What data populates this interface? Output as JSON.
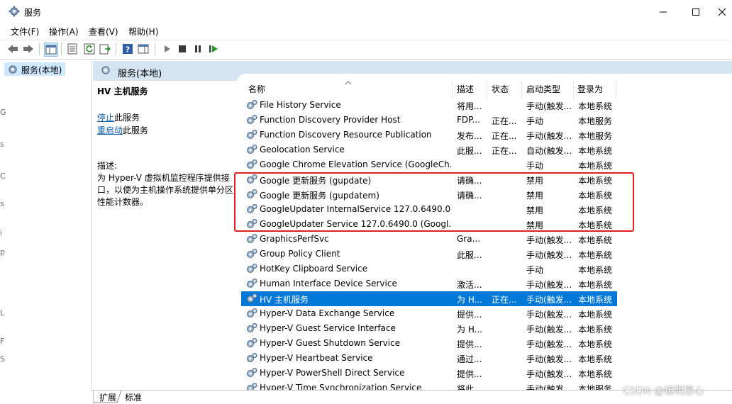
{
  "window": {
    "title": "服务"
  },
  "menu": [
    "文件(F)",
    "操作(A)",
    "查看(V)",
    "帮助(H)"
  ],
  "tree": {
    "selected_label": "服务(本地)"
  },
  "left_edge_chars": [
    "G",
    "s",
    "C",
    "s",
    "i",
    "p",
    "L",
    "F",
    "S"
  ],
  "right_header": {
    "title": "服务(本地)"
  },
  "description": {
    "service_title": "HV 主机服务",
    "stop_link": "停止",
    "stop_suffix": "此服务",
    "restart_link": "重启动",
    "restart_suffix": "此服务",
    "desc_label": "描述:",
    "desc_text": "为 Hyper-V 虚拟机监控程序提供接口，以便为主机操作系统提供单分区性能计数器。"
  },
  "columns": {
    "name": "名称",
    "desc": "描述",
    "status": "状态",
    "startup": "启动类型",
    "logon": "登录为"
  },
  "services": [
    {
      "name": "File History Service",
      "desc": "将用...",
      "status": "",
      "startup": "手动(触发...",
      "logon": "本地系统"
    },
    {
      "name": "Function Discovery Provider Host",
      "desc": "FDP...",
      "status": "正在...",
      "startup": "手动",
      "logon": "本地服务"
    },
    {
      "name": "Function Discovery Resource Publication",
      "desc": "发布...",
      "status": "正在...",
      "startup": "手动(触发...",
      "logon": "本地服务"
    },
    {
      "name": "Geolocation Service",
      "desc": "此服...",
      "status": "正在...",
      "startup": "自动(触发...",
      "logon": "本地系统"
    },
    {
      "name": "Google Chrome Elevation Service (GoogleCh...",
      "desc": "",
      "status": "",
      "startup": "手动",
      "logon": "本地系统"
    },
    {
      "name": "Google 更新服务 (gupdate)",
      "desc": "请确...",
      "status": "",
      "startup": "禁用",
      "logon": "本地系统"
    },
    {
      "name": "Google 更新服务 (gupdatem)",
      "desc": "请确...",
      "status": "",
      "startup": "禁用",
      "logon": "本地系统"
    },
    {
      "name": "GoogleUpdater InternalService 127.0.6490.0 ...",
      "desc": "",
      "status": "",
      "startup": "禁用",
      "logon": "本地系统"
    },
    {
      "name": "GoogleUpdater Service 127.0.6490.0 (Googl...",
      "desc": "",
      "status": "",
      "startup": "禁用",
      "logon": "本地系统"
    },
    {
      "name": "GraphicsPerfSvc",
      "desc": "Gra...",
      "status": "",
      "startup": "手动(触发...",
      "logon": "本地系统"
    },
    {
      "name": "Group Policy Client",
      "desc": "此服...",
      "status": "",
      "startup": "手动(触发...",
      "logon": "本地系统"
    },
    {
      "name": "HotKey Clipboard Service",
      "desc": "",
      "status": "",
      "startup": "手动",
      "logon": "本地系统"
    },
    {
      "name": "Human Interface Device Service",
      "desc": "激活...",
      "status": "",
      "startup": "手动(触发...",
      "logon": "本地系统"
    },
    {
      "name": "HV 主机服务",
      "desc": "为 H...",
      "status": "正在...",
      "startup": "手动(触发...",
      "logon": "本地系统"
    },
    {
      "name": "Hyper-V Data Exchange Service",
      "desc": "提供...",
      "status": "",
      "startup": "手动(触发...",
      "logon": "本地系统"
    },
    {
      "name": "Hyper-V Guest Service Interface",
      "desc": "为 H...",
      "status": "",
      "startup": "手动(触发...",
      "logon": "本地系统"
    },
    {
      "name": "Hyper-V Guest Shutdown Service",
      "desc": "提供...",
      "status": "",
      "startup": "手动(触发...",
      "logon": "本地系统"
    },
    {
      "name": "Hyper-V Heartbeat Service",
      "desc": "通过...",
      "status": "",
      "startup": "手动(触发...",
      "logon": "本地系统"
    },
    {
      "name": "Hyper-V PowerShell Direct Service",
      "desc": "提供...",
      "status": "",
      "startup": "手动(触发...",
      "logon": "本地系统"
    },
    {
      "name": "Hyper-V Time Synchronization Service",
      "desc": "将此...",
      "status": "",
      "startup": "手动(触发...",
      "logon": "本地服务"
    }
  ],
  "selected_service": "HV 主机服务",
  "tabs": [
    "扩展",
    "标准"
  ],
  "watermark": "CSDN @镜明思心",
  "colors": {
    "selection": "#0078d7",
    "highlight_box": "#e02020",
    "header_band": "#d6e4f2"
  }
}
